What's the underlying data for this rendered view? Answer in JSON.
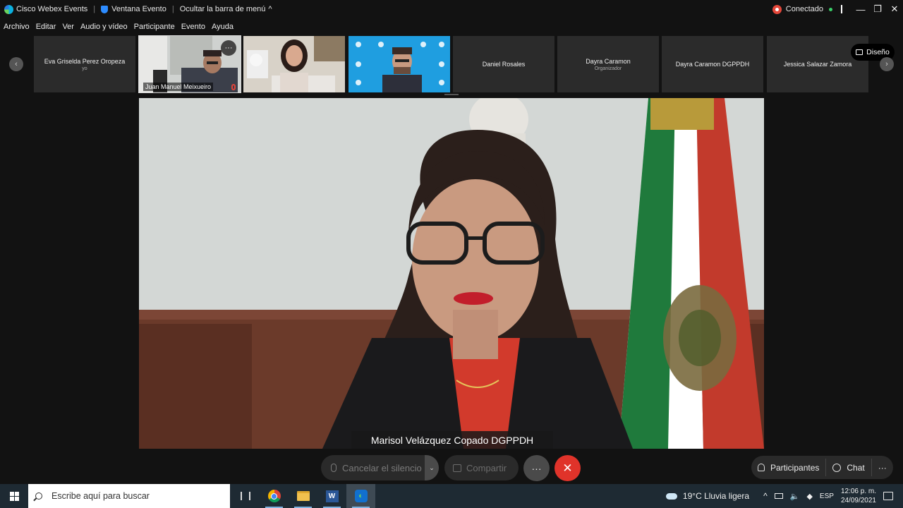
{
  "titlebar": {
    "app_name": "Cisco Webex Events",
    "event_window": "Ventana Evento",
    "hide_menu": "Ocultar la barra de menú",
    "hide_menu_caret": "^",
    "status": "Conectado",
    "minimize": "—",
    "restore": "❐",
    "close": "✕"
  },
  "menu": [
    "Archivo",
    "Editar",
    "Ver",
    "Audio y vídeo",
    "Participante",
    "Evento",
    "Ayuda"
  ],
  "strip": {
    "prev": "‹",
    "next": "›",
    "layout_button": "Diseño",
    "participants": [
      {
        "name": "Eva Griselda Perez Oropeza",
        "sub": "yo",
        "video": false
      },
      {
        "name": "Juan Manuel Meixueiro",
        "sub": "",
        "video": true,
        "active": true,
        "more": "···"
      },
      {
        "name": "",
        "sub": "",
        "video": true
      },
      {
        "name": "",
        "sub": "",
        "video": true
      },
      {
        "name": "Daniel Rosales",
        "sub": "",
        "video": false
      },
      {
        "name": "Dayra Caramon",
        "sub": "Organizador",
        "video": false
      },
      {
        "name": "Dayra Caramon  DGPPDH",
        "sub": "",
        "video": false
      },
      {
        "name": "Jessica Salazar Zamora",
        "sub": "",
        "video": false
      }
    ]
  },
  "main": {
    "speaker": "Marisol Velázquez Copado DGPPDH"
  },
  "controls": {
    "unmute": "Cancelar el silencio",
    "unmute_caret": "⌄",
    "share": "Compartir",
    "more": "···",
    "leave": "✕",
    "participants": "Participantes",
    "chat": "Chat",
    "overflow": "···"
  },
  "taskbar": {
    "search_placeholder": "Escribe aquí para buscar",
    "word_letter": "W",
    "weather": "19°C  Lluvia ligera",
    "lang": "ESP",
    "time": "12:06 p. m.",
    "date": "24/09/2021",
    "tray_caret": "^",
    "speaker_glyph": "🔈"
  },
  "colors": {
    "accent_leave": "#e0332a",
    "recording": "#e4473a",
    "connected": "#3ad06a",
    "panel": "#2b2b2b",
    "background": "#121212"
  }
}
